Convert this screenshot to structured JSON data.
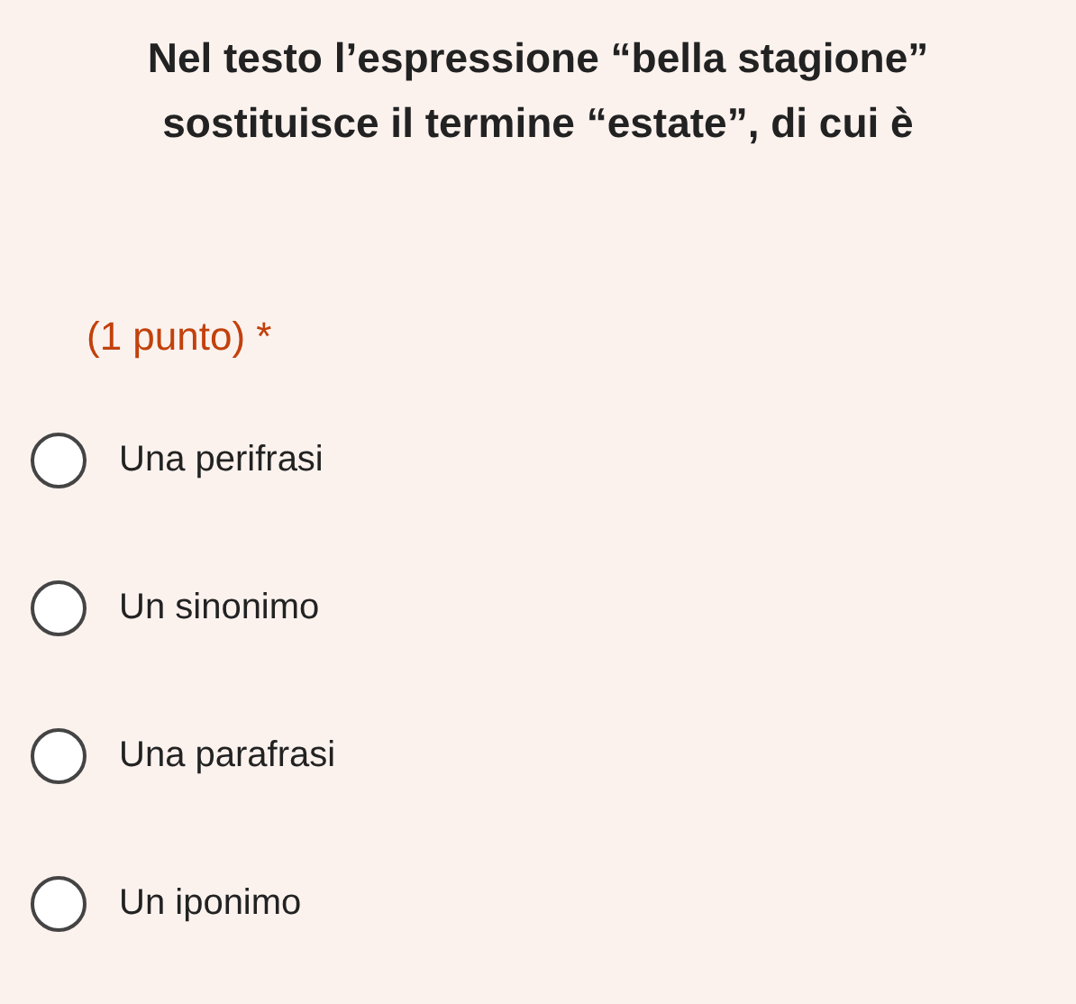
{
  "question": {
    "title": "Nel testo l’espressione “bella stagione” sostituisce il termine “estate”, di cui è",
    "points": "(1 punto) *"
  },
  "options": [
    {
      "label": "Una perifrasi",
      "selected": false
    },
    {
      "label": "Un sinonimo",
      "selected": false
    },
    {
      "label": "Una parafrasi",
      "selected": false
    },
    {
      "label": "Un iponimo",
      "selected": false
    }
  ]
}
